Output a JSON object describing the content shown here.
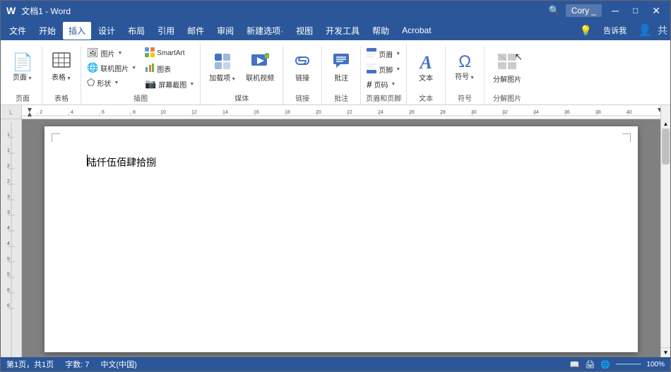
{
  "titlebar": {
    "title": "文档1 - Word",
    "user": "Cory _",
    "icons": {
      "search": "🔍",
      "user": "👤"
    }
  },
  "menubar": {
    "items": [
      "文件",
      "开始",
      "插入",
      "设计",
      "布局",
      "引用",
      "邮件",
      "审阅",
      "新建选项·",
      "视图",
      "开发工具",
      "帮助",
      "Acrobat"
    ],
    "active": "插入",
    "right_items": [
      "告诉我"
    ]
  },
  "ribbon": {
    "groups": [
      {
        "label": "页面",
        "items": [
          {
            "type": "large",
            "icon": "📄",
            "label": "页面",
            "has_arrow": true
          }
        ]
      },
      {
        "label": "表格",
        "items": [
          {
            "type": "large",
            "icon": "⊞",
            "label": "表格",
            "has_arrow": true
          }
        ]
      },
      {
        "label": "插图",
        "items": [
          {
            "type": "small_group",
            "items": [
              {
                "icon": "🖼",
                "label": "图片",
                "has_arrow": true
              },
              {
                "icon": "📊",
                "label": "联机图片",
                "has_arrow": true
              },
              {
                "icon": "⬠",
                "label": "形状·",
                "has_arrow": true
              }
            ]
          },
          {
            "type": "small_group",
            "items": [
              {
                "icon": "🔲",
                "label": "SmartArt"
              },
              {
                "icon": "📈",
                "label": "图表"
              },
              {
                "icon": "📷",
                "label": "屏幕截图·"
              }
            ]
          }
        ]
      },
      {
        "label": "媒体",
        "items": [
          {
            "type": "large",
            "icon": "⊞",
            "label": "加载项·",
            "has_arrow": true
          },
          {
            "type": "large",
            "icon": "▶",
            "label": "联机视频"
          }
        ]
      },
      {
        "label": "链接",
        "items": [
          {
            "type": "large",
            "icon": "🔗",
            "label": "链接",
            "has_arrow": false
          }
        ]
      },
      {
        "label": "批注",
        "items": [
          {
            "type": "large",
            "icon": "💬",
            "label": "批注"
          }
        ]
      },
      {
        "label": "页眉和页脚",
        "items": [
          {
            "type": "small_group",
            "items": [
              {
                "icon": "▤",
                "label": "页眉·"
              },
              {
                "icon": "▥",
                "label": "页脚·"
              },
              {
                "icon": "#",
                "label": "页码·"
              }
            ]
          }
        ]
      },
      {
        "label": "文本",
        "items": [
          {
            "type": "large",
            "icon": "A",
            "label": "文本"
          }
        ]
      },
      {
        "label": "符号",
        "items": [
          {
            "type": "large",
            "icon": "Ω",
            "label": "符号",
            "has_arrow": true
          }
        ]
      },
      {
        "label": "分解图片",
        "items": [
          {
            "type": "large",
            "icon": "⊞",
            "label": "分解图片"
          }
        ]
      }
    ]
  },
  "ruler": {
    "marks": [
      2,
      4,
      6,
      8,
      10,
      12,
      14,
      16,
      18,
      20,
      22,
      24,
      26,
      28,
      30,
      32,
      34,
      36,
      38,
      40
    ]
  },
  "document": {
    "content": "陆仟伍佰肆拾捌"
  },
  "statusbar": {
    "page": "第1页，共1页",
    "words": "字数: 7",
    "language": "中文(中国)"
  }
}
